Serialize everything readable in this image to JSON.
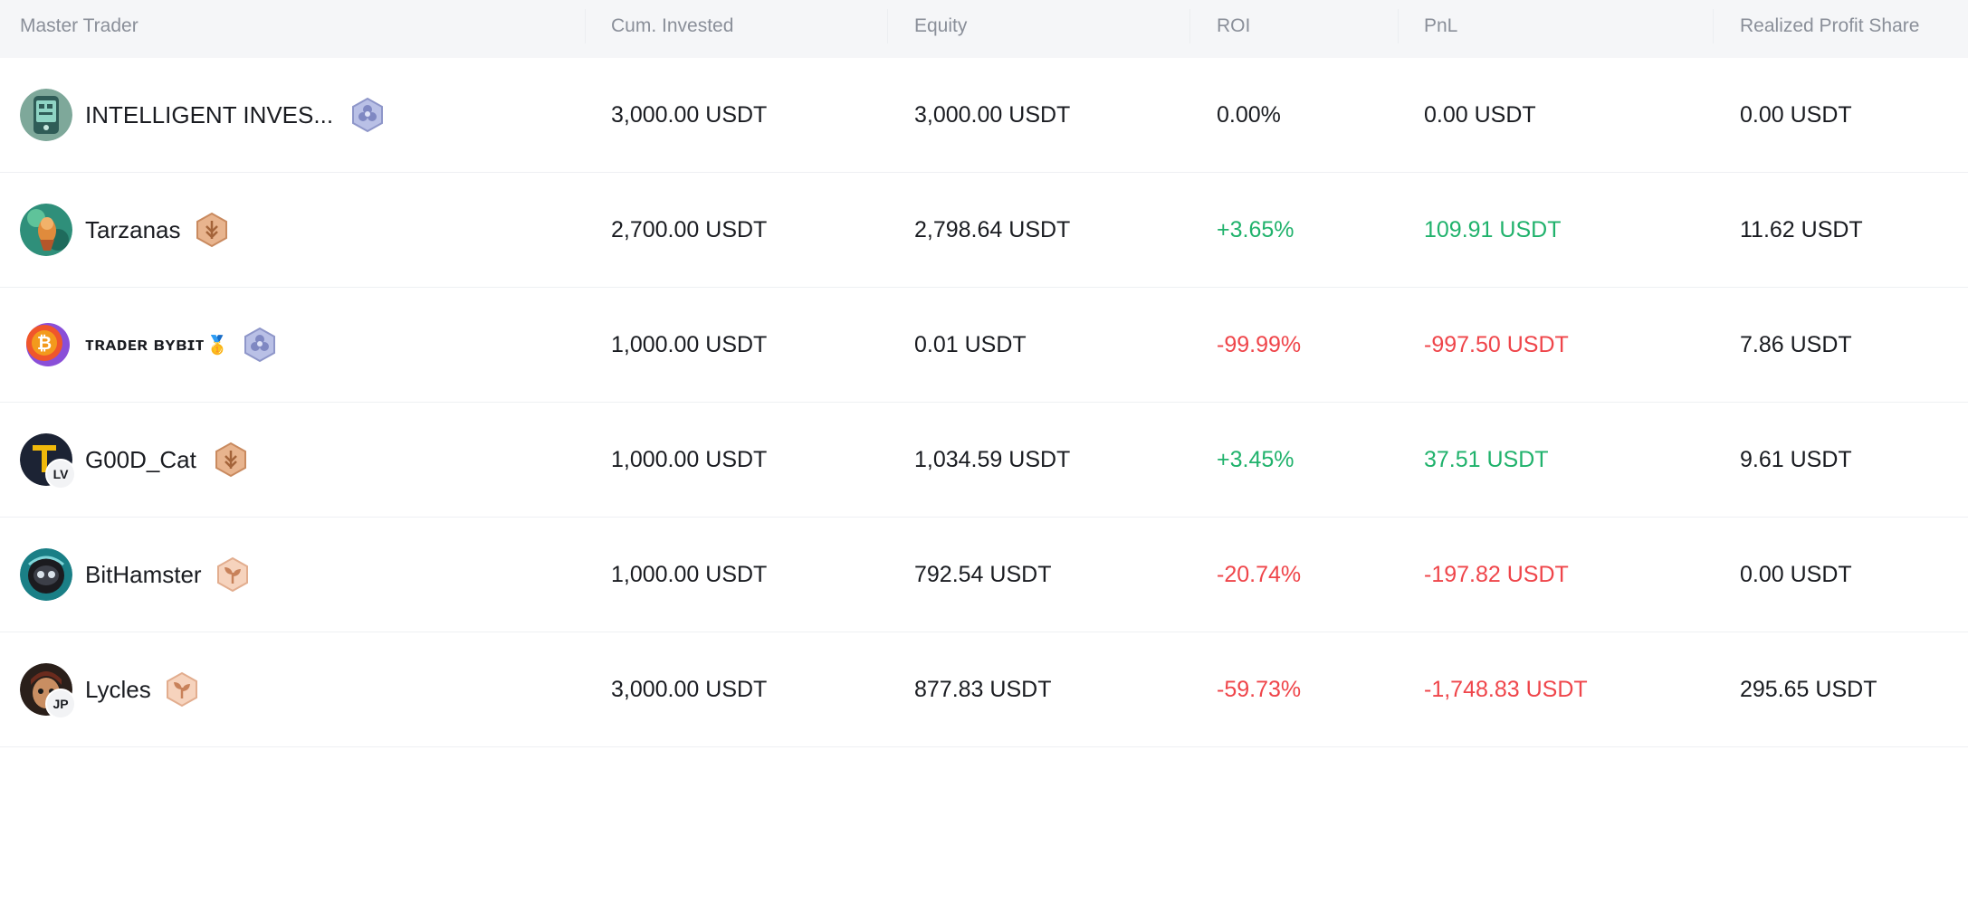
{
  "columns": {
    "trader": "Master Trader",
    "invested": "Cum. Invested",
    "equity": "Equity",
    "roi": "ROI",
    "pnl": "PnL",
    "profit_share": "Realized Profit Share"
  },
  "colors": {
    "positive": "#20b26c",
    "negative": "#ef454a",
    "text": "#1a1c21",
    "header_text": "#8a8f99",
    "header_bg": "#f5f6f8"
  },
  "rows": [
    {
      "name": "INTELLIGENT INVES...",
      "avatar_badge": "",
      "level_icon": "diamond-level-icon",
      "invested": "3,000.00 USDT",
      "equity": "3,000.00 USDT",
      "roi": "0.00%",
      "pnl": "0.00 USDT",
      "profit_share": "0.00 USDT",
      "trend": "neutral"
    },
    {
      "name": "Tarzanas",
      "avatar_badge": "",
      "level_icon": "bronze-level-icon",
      "invested": "2,700.00 USDT",
      "equity": "2,798.64 USDT",
      "roi": "+3.65%",
      "pnl": "109.91 USDT",
      "profit_share": "11.62 USDT",
      "trend": "positive"
    },
    {
      "name": "ᴛʀᴀᴅᴇʀ ʙʏʙɪᴛ",
      "name_medal": "🥇",
      "avatar_badge": "",
      "level_icon": "diamond-level-icon",
      "invested": "1,000.00 USDT",
      "equity": "0.01 USDT",
      "roi": "-99.99%",
      "pnl": "-997.50 USDT",
      "profit_share": "7.86 USDT",
      "trend": "negative"
    },
    {
      "name": "G00D_Cat",
      "avatar_badge": "LV",
      "level_icon": "bronze-level-icon",
      "invested": "1,000.00 USDT",
      "equity": "1,034.59 USDT",
      "roi": "+3.45%",
      "pnl": "37.51 USDT",
      "profit_share": "9.61 USDT",
      "trend": "positive"
    },
    {
      "name": "BitHamster",
      "avatar_badge": "",
      "level_icon": "sprout-level-icon",
      "invested": "1,000.00 USDT",
      "equity": "792.54 USDT",
      "roi": "-20.74%",
      "pnl": "-197.82 USDT",
      "profit_share": "0.00 USDT",
      "trend": "negative"
    },
    {
      "name": "Lycles",
      "avatar_badge": "JP",
      "level_icon": "sprout-level-icon",
      "invested": "3,000.00 USDT",
      "equity": "877.83 USDT",
      "roi": "-59.73%",
      "pnl": "-1,748.83 USDT",
      "profit_share": "295.65 USDT",
      "trend": "negative"
    }
  ]
}
